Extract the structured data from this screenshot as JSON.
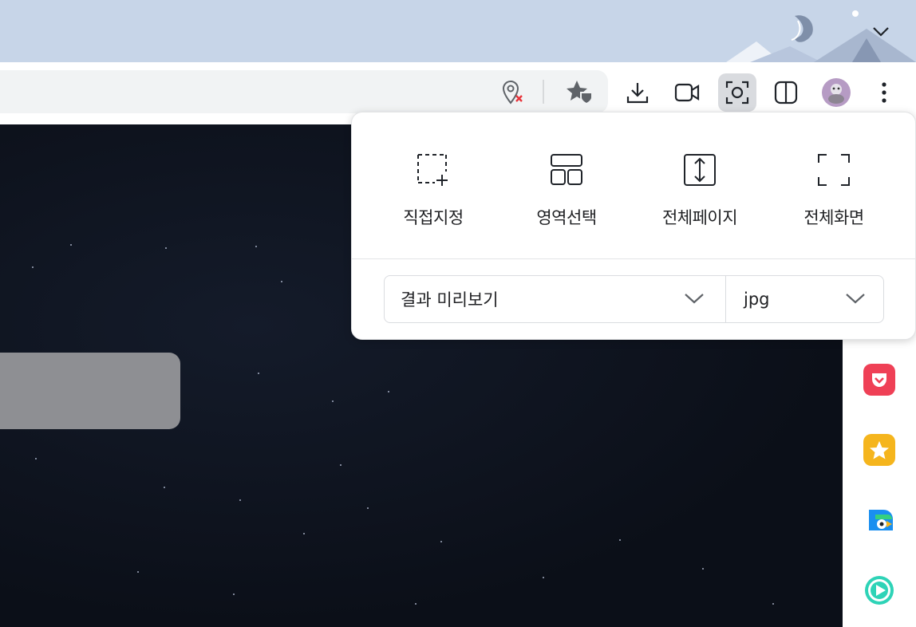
{
  "toolbar": {
    "icons": [
      "location-blocked-icon",
      "favorite-star-icon",
      "download-icon",
      "video-capture-icon",
      "screen-capture-icon",
      "split-view-icon",
      "profile-avatar",
      "more-menu-icon"
    ]
  },
  "capture_popup": {
    "modes": [
      {
        "label": "직접지정",
        "icon": "custom-area-icon"
      },
      {
        "label": "영역선택",
        "icon": "region-select-icon"
      },
      {
        "label": "전체페이지",
        "icon": "full-page-icon"
      },
      {
        "label": "전체화면",
        "icon": "full-screen-icon"
      }
    ],
    "result_select": {
      "value": "결과 미리보기"
    },
    "format_select": {
      "value": "jpg"
    }
  },
  "sidebar": {
    "apps": [
      "pocket-app-icon",
      "bookmark-star-app-icon",
      "edge-bird-app-icon",
      "play-app-icon"
    ]
  },
  "colors": {
    "tabstrip": "#c7d5e8",
    "pocket": "#ef4056",
    "star_app": "#f5b51d",
    "play_app": "#2ed3b7"
  }
}
